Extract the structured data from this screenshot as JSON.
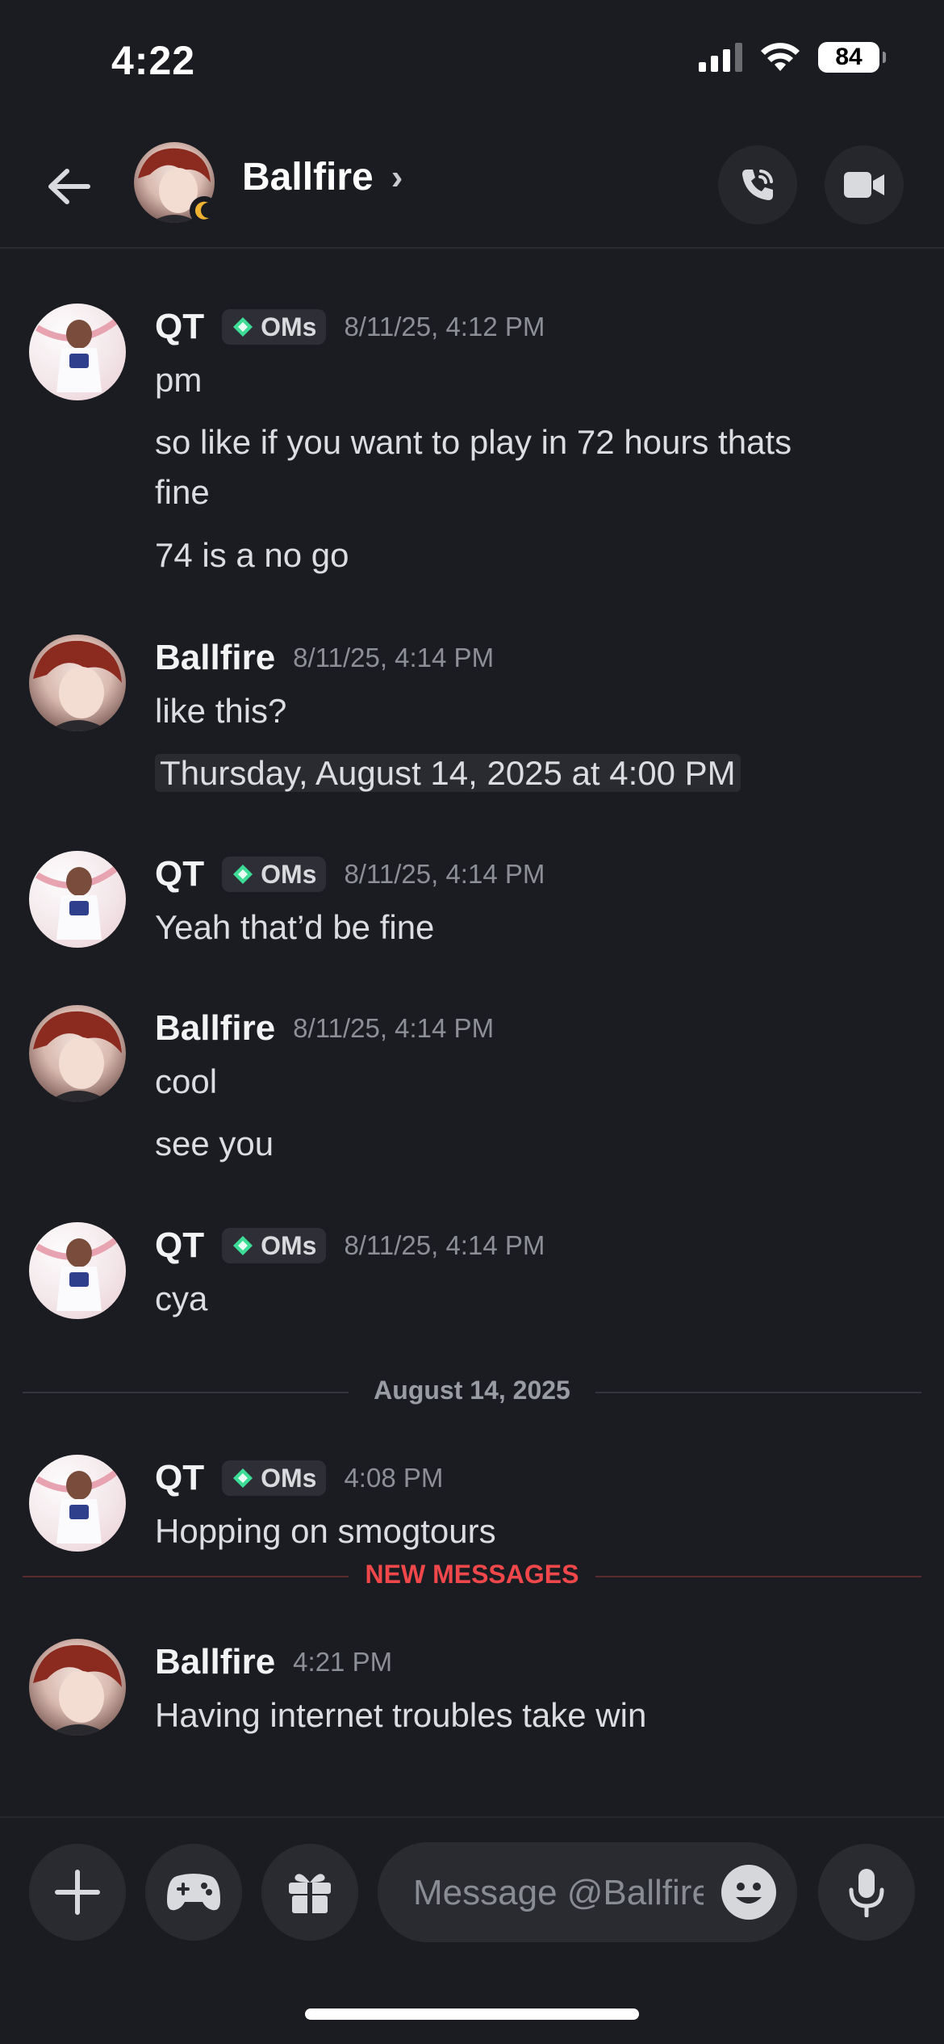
{
  "status_bar": {
    "time": "4:22",
    "battery": "84"
  },
  "header": {
    "title": "Ballfire",
    "chevron": "›"
  },
  "badge_label": "OMs",
  "messages": [
    {
      "author": "QT",
      "has_badge": true,
      "timestamp": "8/11/25, 4:12 PM",
      "lines": [
        "pm",
        "so like if you want to play in 72 hours thats",
        "fine",
        "74 is a no go"
      ]
    },
    {
      "author": "Ballfire",
      "has_badge": false,
      "timestamp": "8/11/25, 4:14 PM",
      "lines": [
        "like this?",
        "Thursday, August 14, 2025 at 4:00 PM"
      ]
    },
    {
      "author": "QT",
      "has_badge": true,
      "timestamp": "8/11/25, 4:14 PM",
      "lines": [
        "Yeah that’d be fine"
      ]
    },
    {
      "author": "Ballfire",
      "has_badge": false,
      "timestamp": "8/11/25, 4:14 PM",
      "lines": [
        "cool",
        "see you"
      ]
    },
    {
      "author": "QT",
      "has_badge": true,
      "timestamp": "8/11/25, 4:14 PM",
      "lines": [
        "cya"
      ]
    },
    {
      "author": "QT",
      "has_badge": true,
      "timestamp": "4:08 PM",
      "lines": [
        "Hopping on smogtours"
      ]
    },
    {
      "author": "Ballfire",
      "has_badge": false,
      "timestamp": "4:21 PM",
      "lines": [
        "Having internet troubles take win"
      ]
    }
  ],
  "date_divider": "August 14, 2025",
  "new_messages_divider": "NEW MESSAGES",
  "composer": {
    "placeholder": "Message @Ballfire"
  },
  "colors": {
    "background": "#1b1c21",
    "new_messages": "#f0474b",
    "badge_gem": "#3ddc97"
  }
}
